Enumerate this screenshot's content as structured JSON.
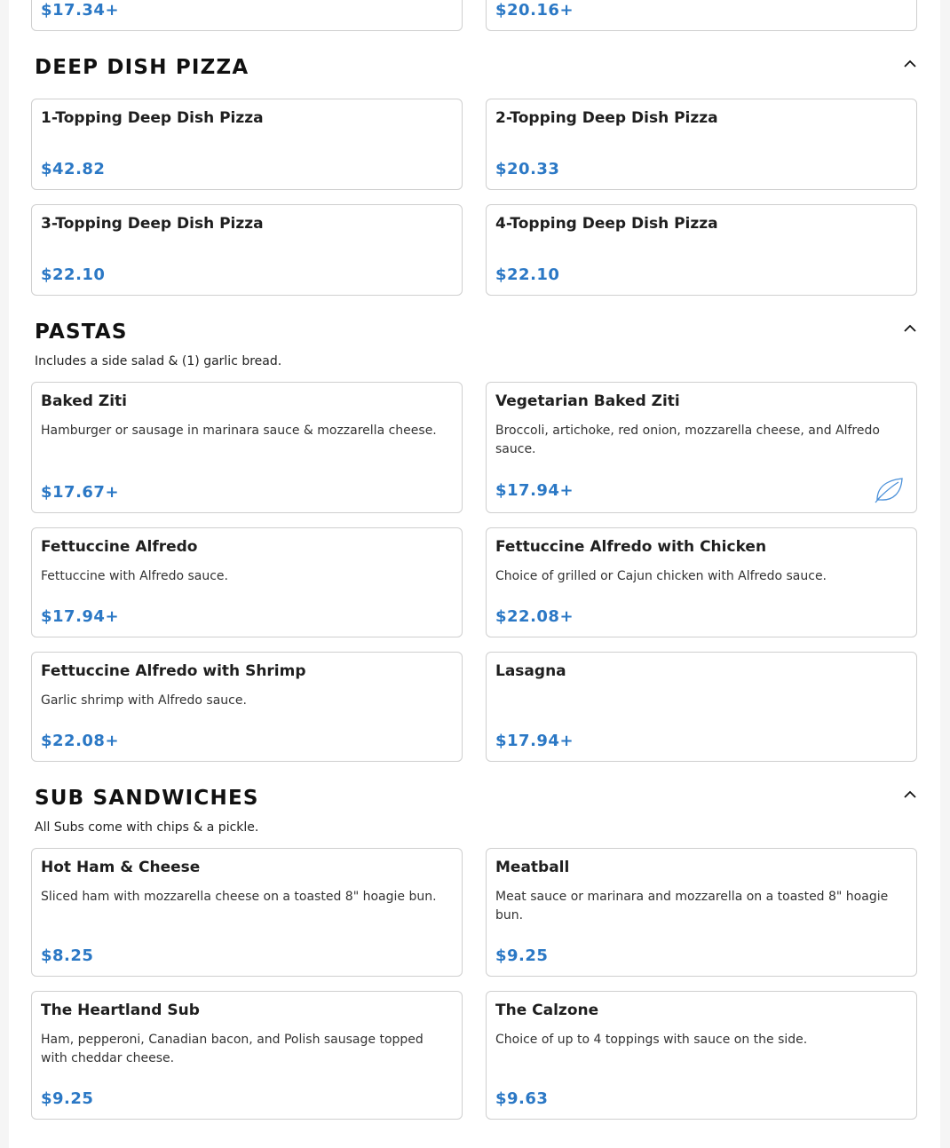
{
  "top_row": {
    "left_price": "$17.34+",
    "right_price": "$20.16+"
  },
  "sections": {
    "deep_dish": {
      "title": "DEEP DISH PIZZA",
      "items": [
        {
          "name": "1-Topping Deep Dish Pizza",
          "price": "$42.82"
        },
        {
          "name": "2-Topping Deep Dish Pizza",
          "price": "$20.33"
        },
        {
          "name": "3-Topping Deep Dish Pizza",
          "price": "$22.10"
        },
        {
          "name": "4-Topping Deep Dish Pizza",
          "price": "$22.10"
        }
      ]
    },
    "pastas": {
      "title": "PASTAS",
      "note": "Includes a side salad & (1) garlic bread.",
      "items": [
        {
          "name": "Baked Ziti",
          "description": "Hamburger or sausage in marinara sauce & mozzarella cheese.",
          "price": "$17.67+"
        },
        {
          "name": "Vegetarian Baked Ziti",
          "description": "Broccoli, artichoke, red onion, mozzarella cheese, and Alfredo sauce.",
          "price": "$17.94+",
          "icon": "vegetarian-leaf-icon"
        },
        {
          "name": "Fettuccine Alfredo",
          "description": "Fettuccine with Alfredo sauce.",
          "price": "$17.94+"
        },
        {
          "name": "Fettuccine Alfredo with Chicken",
          "description": "Choice of grilled or Cajun chicken with Alfredo sauce.",
          "price": "$22.08+"
        },
        {
          "name": "Fettuccine Alfredo with Shrimp",
          "description": "Garlic shrimp with Alfredo sauce.",
          "price": "$22.08+"
        },
        {
          "name": "Lasagna",
          "price": "$17.94+"
        }
      ]
    },
    "subs": {
      "title": "SUB SANDWICHES",
      "note": "All Subs come with chips & a pickle.",
      "items": [
        {
          "name": "Hot Ham & Cheese",
          "description": "Sliced ham with mozzarella cheese on a toasted 8\" hoagie bun.",
          "price": "$8.25"
        },
        {
          "name": "Meatball",
          "description": "Meat sauce or marinara and mozzarella on a toasted 8\" hoagie bun.",
          "price": "$9.25"
        },
        {
          "name": "The Heartland Sub",
          "description": "Ham, pepperoni, Canadian bacon, and Polish sausage topped with cheddar cheese.",
          "price": "$9.25"
        },
        {
          "name": "The Calzone",
          "description": "Choice of up to 4 toppings with sauce on the side.",
          "price": "$9.63"
        }
      ]
    }
  },
  "colors": {
    "price": "#2b78c5",
    "border": "#cfcfcf",
    "title": "#111111"
  }
}
